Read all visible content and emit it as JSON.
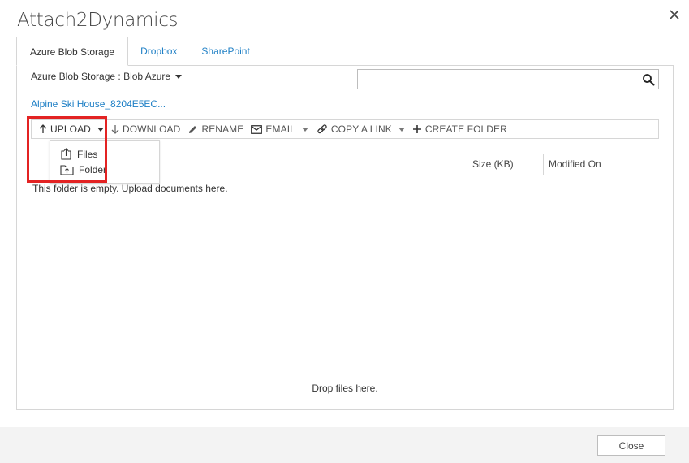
{
  "dialog": {
    "title": "Attach2Dynamics",
    "close_icon": "close-icon"
  },
  "tabs": [
    {
      "label": "Azure Blob Storage",
      "active": true
    },
    {
      "label": "Dropbox",
      "active": false
    },
    {
      "label": "SharePoint",
      "active": false
    }
  ],
  "storage": {
    "selected": "Azure Blob Storage : Blob Azure"
  },
  "search": {
    "value": "",
    "placeholder": "",
    "icon": "search-icon"
  },
  "breadcrumb": {
    "path": "Alpine Ski House_8204E5EC..."
  },
  "toolbar": {
    "upload": "UPLOAD",
    "download": "DOWNLOAD",
    "rename": "RENAME",
    "email": "EMAIL",
    "copy_link": "COPY A LINK",
    "create_folder": "CREATE FOLDER"
  },
  "upload_menu": {
    "items": [
      {
        "label": "Files",
        "icon": "upload-file-icon"
      },
      {
        "label": "Folder",
        "icon": "upload-folder-icon"
      }
    ]
  },
  "grid": {
    "columns": [
      "Size (KB)",
      "Modified On"
    ],
    "empty_message": "This folder is empty. Upload documents here.",
    "drop_message": "Drop files here."
  },
  "footer": {
    "close_label": "Close"
  },
  "colors": {
    "accent_link": "#1e7fc5",
    "highlight": "#e32323",
    "footer_bg": "#f3f3f3"
  }
}
